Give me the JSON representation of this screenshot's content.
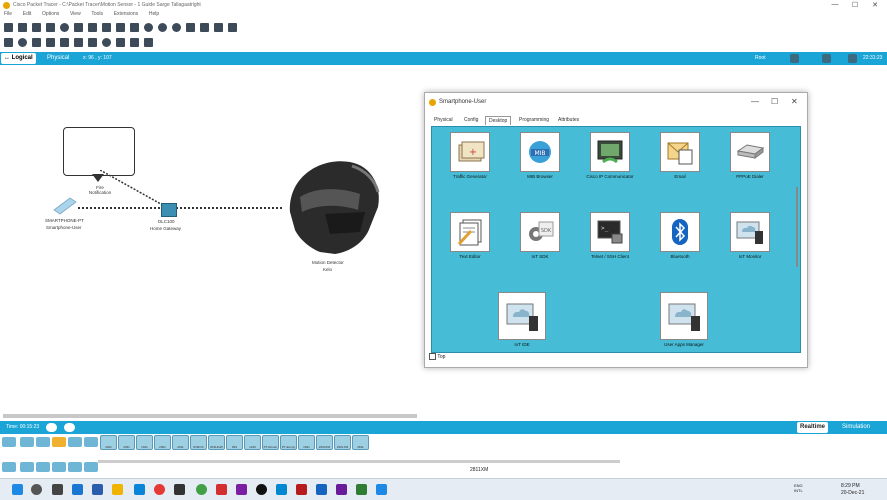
{
  "window": {
    "title": "Cisco Packet Tracer - C:\\Packet Tracer\\Motion Sensor - 1 Guide Sarge Tallagaatright",
    "controls": [
      "—",
      "☐",
      "✕"
    ]
  },
  "menu": [
    "File",
    "Edit",
    "Options",
    "View",
    "Tools",
    "Extensions",
    "Help"
  ],
  "mode_tabs": {
    "logical": "Logical",
    "physical": "Physical",
    "coords": "x: 96 , y: 107",
    "root": "Root",
    "time": "22:31:23"
  },
  "workspace": {
    "fire_notification": "Fire\nNotification",
    "smartphone_model": "SMARTPHONE-PT",
    "smartphone_name": "Smartphone-User",
    "gateway_model": "DLC100",
    "gateway_name": "Home Gateway",
    "sensor_model": "Motion Detector",
    "sensor_name": "Kelo"
  },
  "dialog": {
    "title": "Smartphone-User",
    "tabs": [
      "Physical",
      "Config",
      "Desktop",
      "Programming",
      "Attributes"
    ],
    "active_tab": "Desktop",
    "apps": [
      {
        "name": "Traffic Generator",
        "icon": "envelopes-icon"
      },
      {
        "name": "MIB Browser",
        "icon": "mib-icon"
      },
      {
        "name": "Cisco IP Communicator",
        "icon": "ip-phone-icon"
      },
      {
        "name": "Email",
        "icon": "email-icon"
      },
      {
        "name": "PPPoE Dialer",
        "icon": "pppoe-icon"
      },
      {
        "name": "Text Editor",
        "icon": "text-editor-icon"
      },
      {
        "name": "IoT SDK",
        "icon": "sdk-icon"
      },
      {
        "name": "Telnet / SSH Client",
        "icon": "terminal-icon"
      },
      {
        "name": "Bluetooth",
        "icon": "bluetooth-icon"
      },
      {
        "name": "IoT Monitor",
        "icon": "iot-monitor-icon"
      },
      {
        "name": "IoT IDE",
        "icon": "iot-ide-icon"
      },
      {
        "name": "User Apps Manager",
        "icon": "apps-manager-icon"
      }
    ],
    "top_checkbox": "Top"
  },
  "status": {
    "time": "Time: 00:15:23",
    "realtime": "Realtime",
    "simulation": "Simulation",
    "device_model": "2811XM"
  },
  "devices_row": [
    "4321",
    "4331",
    "1941",
    "2901",
    "2911",
    "819IOX",
    "819HGW",
    "829",
    "1240",
    "PT-Router",
    "PT-Empty",
    "1841",
    "2620XM",
    "2621XM",
    "2811"
  ],
  "taskbar": {
    "lang": "ENG\nINTL",
    "clock": "8:29 PM",
    "date": "20-Dec-21"
  },
  "colors": {
    "accent": "#1aa5d6",
    "desktop_bg": "#46bcd6"
  }
}
